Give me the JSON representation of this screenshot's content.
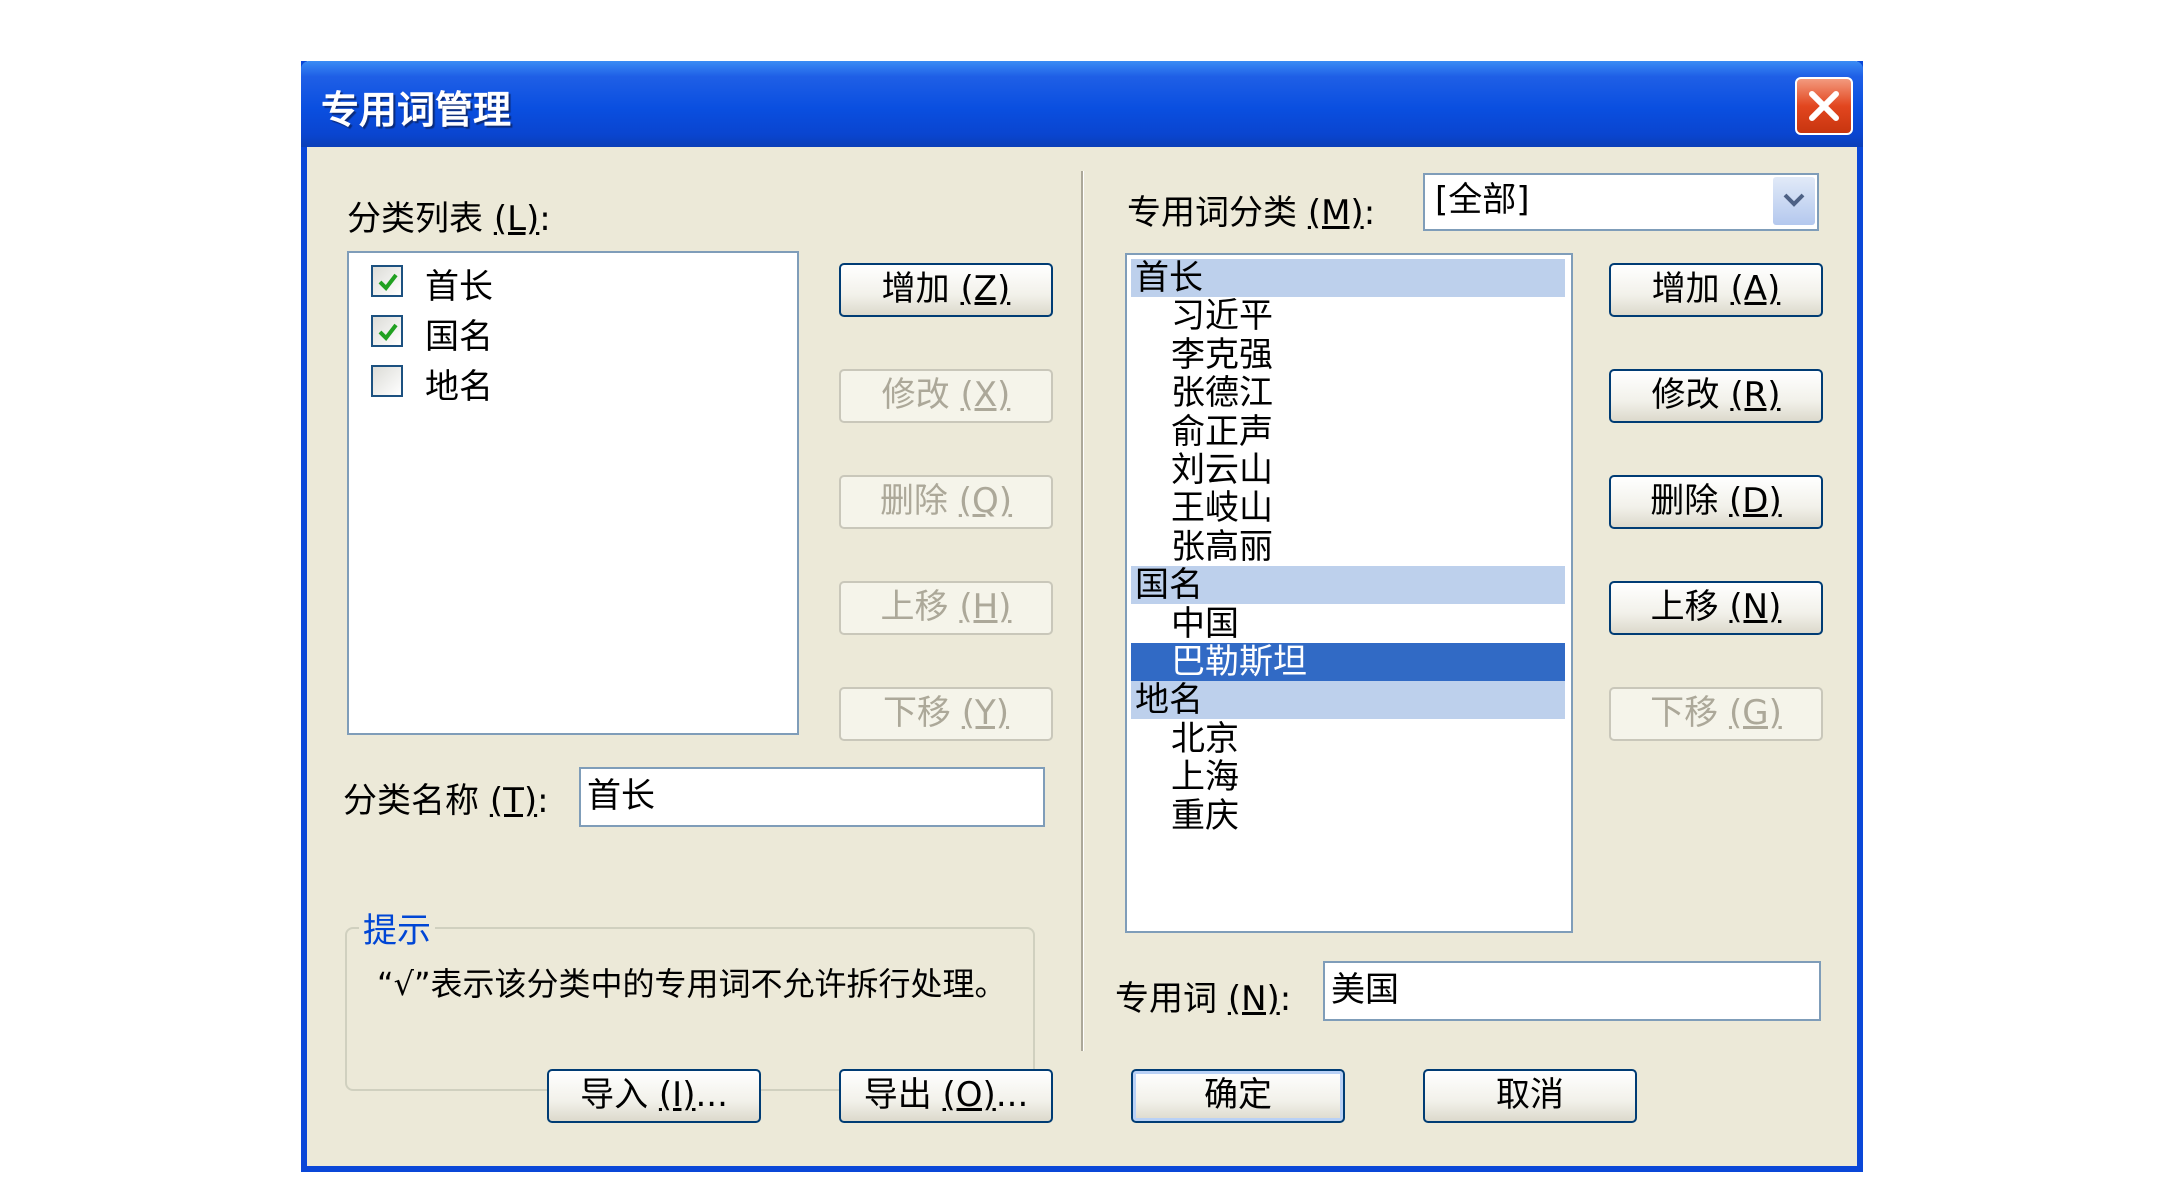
{
  "window": {
    "title": "专用词管理"
  },
  "left": {
    "category_list_label": "分类列表",
    "category_list_key": "(L)",
    "categories": [
      {
        "label": "首长",
        "checked": true
      },
      {
        "label": "国名",
        "checked": true
      },
      {
        "label": "地名",
        "checked": false
      }
    ],
    "buttons": {
      "add": {
        "text": "增加",
        "key": "(Z)"
      },
      "modify": {
        "text": "修改",
        "key": "(X)"
      },
      "delete": {
        "text": "删除",
        "key": "(Q)"
      },
      "move_up": {
        "text": "上移",
        "key": "(H)"
      },
      "move_down": {
        "text": "下移",
        "key": "(Y)"
      }
    },
    "category_name_label": "分类名称",
    "category_name_key": "(T)",
    "category_name_value": "首长",
    "hint_title": "提示",
    "hint_text": "“√”表示该分类中的专用词不允许拆行处理。"
  },
  "right": {
    "word_category_label": "专用词分类",
    "word_category_key": "(M)",
    "word_category_selected": "[全部]",
    "tree": [
      {
        "label": "首长",
        "type": "cat"
      },
      {
        "label": "习近平",
        "type": "child"
      },
      {
        "label": "李克强",
        "type": "child"
      },
      {
        "label": "张德江",
        "type": "child"
      },
      {
        "label": "俞正声",
        "type": "child"
      },
      {
        "label": "刘云山",
        "type": "child"
      },
      {
        "label": "王岐山",
        "type": "child"
      },
      {
        "label": "张高丽",
        "type": "child"
      },
      {
        "label": "国名",
        "type": "cat"
      },
      {
        "label": "中国",
        "type": "child"
      },
      {
        "label": "巴勒斯坦",
        "type": "child",
        "selected": true
      },
      {
        "label": "地名",
        "type": "cat"
      },
      {
        "label": "北京",
        "type": "child"
      },
      {
        "label": "上海",
        "type": "child"
      },
      {
        "label": "重庆",
        "type": "child"
      }
    ],
    "buttons": {
      "add": {
        "text": "增加",
        "key": "(A)"
      },
      "modify": {
        "text": "修改",
        "key": "(R)"
      },
      "delete": {
        "text": "删除",
        "key": "(D)"
      },
      "move_up": {
        "text": "上移",
        "key": "(N)"
      },
      "move_down": {
        "text": "下移",
        "key": "(G)"
      }
    },
    "word_label": "专用词",
    "word_key": "(N)",
    "word_value": "美国"
  },
  "footer": {
    "import": {
      "text": "导入",
      "key": "(I)",
      "suffix": "..."
    },
    "export": {
      "text": "导出",
      "key": "(O)",
      "suffix": "..."
    },
    "ok": "确定",
    "cancel": "取消"
  },
  "colors": {
    "titlebar": "#0a4fe0",
    "dialog_bg": "#ece9d8",
    "selection": "#316ac5",
    "category_row": "#bdd0ec",
    "hint_title": "#0046d5"
  },
  "icons": [
    "close-icon",
    "checkbox-check-icon",
    "chevron-down-icon"
  ]
}
